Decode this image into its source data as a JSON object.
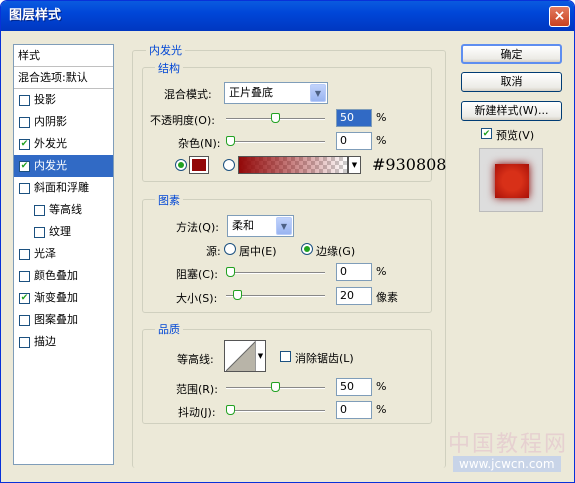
{
  "window": {
    "title": "图层样式",
    "close_icon": "×"
  },
  "left_list": {
    "header": "样式",
    "blend": "混合选项:默认",
    "items": [
      {
        "label": "投影",
        "checked": false,
        "selected": false,
        "indent": false
      },
      {
        "label": "内阴影",
        "checked": false,
        "selected": false,
        "indent": false
      },
      {
        "label": "外发光",
        "checked": true,
        "selected": false,
        "indent": false
      },
      {
        "label": "内发光",
        "checked": true,
        "selected": true,
        "indent": false
      },
      {
        "label": "斜面和浮雕",
        "checked": false,
        "selected": false,
        "indent": false
      },
      {
        "label": "等高线",
        "checked": false,
        "selected": false,
        "indent": true
      },
      {
        "label": "纹理",
        "checked": false,
        "selected": false,
        "indent": true
      },
      {
        "label": "光泽",
        "checked": false,
        "selected": false,
        "indent": false
      },
      {
        "label": "颜色叠加",
        "checked": false,
        "selected": false,
        "indent": false
      },
      {
        "label": "渐变叠加",
        "checked": true,
        "selected": false,
        "indent": false
      },
      {
        "label": "图案叠加",
        "checked": false,
        "selected": false,
        "indent": false
      },
      {
        "label": "描边",
        "checked": false,
        "selected": false,
        "indent": false
      }
    ]
  },
  "panel": {
    "title": "内发光"
  },
  "structure": {
    "title": "结构",
    "blend_mode_label": "混合模式:",
    "blend_mode": "正片叠底",
    "opacity_label": "不透明度(O):",
    "opacity": "50",
    "opacity_unit": "%",
    "opacity_level": 0.5,
    "noise_label": "杂色(N):",
    "noise": "0",
    "noise_unit": "%",
    "noise_level": 0,
    "color": "#930808",
    "color_hex_label": "#930808",
    "gradient_color": "#930808"
  },
  "elements": {
    "title": "图素",
    "method_label": "方法(Q):",
    "method": "柔和",
    "source_label": "源:",
    "source_center": "居中(E)",
    "source_edge": "边缘(G)",
    "choke_label": "阻塞(C):",
    "choke": "0",
    "choke_unit": "%",
    "choke_level": 0,
    "size_label": "大小(S):",
    "size": "20",
    "size_unit": "像素",
    "size_level": 0.08
  },
  "quality": {
    "title": "品质",
    "contour_label": "等高线:",
    "antialias_label": "消除锯齿(L)",
    "range_label": "范围(R):",
    "range": "50",
    "range_unit": "%",
    "range_level": 0.5,
    "jitter_label": "抖动(J):",
    "jitter": "0",
    "jitter_unit": "%",
    "jitter_level": 0
  },
  "buttons": {
    "ok": "确定",
    "cancel": "取消",
    "new_style": "新建样式(W)...",
    "preview": "预览(V)"
  },
  "watermark": {
    "line1": "中国教程网",
    "line2": "www.jcwcn.com"
  },
  "colors": {
    "selection": "#316ac5",
    "check": "#21a121"
  }
}
